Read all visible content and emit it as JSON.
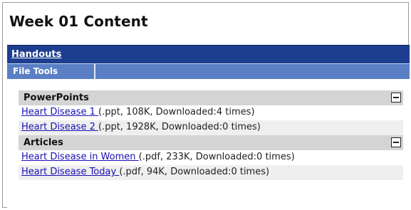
{
  "page_title": "Week 01 Content",
  "header": {
    "link_label": "Handouts"
  },
  "tools": {
    "tab_label": "File Tools"
  },
  "sections": [
    {
      "title": "PowerPoints",
      "items": [
        {
          "link": "Heart Disease 1 ",
          "meta": "(.ppt, 108K, Downloaded:4 times)"
        },
        {
          "link": "Heart Disease 2 ",
          "meta": "(.ppt, 1928K, Downloaded:0 times)"
        }
      ]
    },
    {
      "title": "Articles",
      "items": [
        {
          "link": "Heart Disease in Women ",
          "meta": "(.pdf, 233K, Downloaded:0 times)"
        },
        {
          "link": "Heart Disease Today ",
          "meta": "(.pdf, 94K, Downloaded:0 times)"
        }
      ]
    }
  ],
  "icons": {
    "collapse": "minus-box-icon"
  },
  "colors": {
    "header_bar": "#1d3e8f",
    "tools_bar": "#5a7fc4",
    "link": "#1a0fb4",
    "section_header": "#d4d4d4"
  }
}
